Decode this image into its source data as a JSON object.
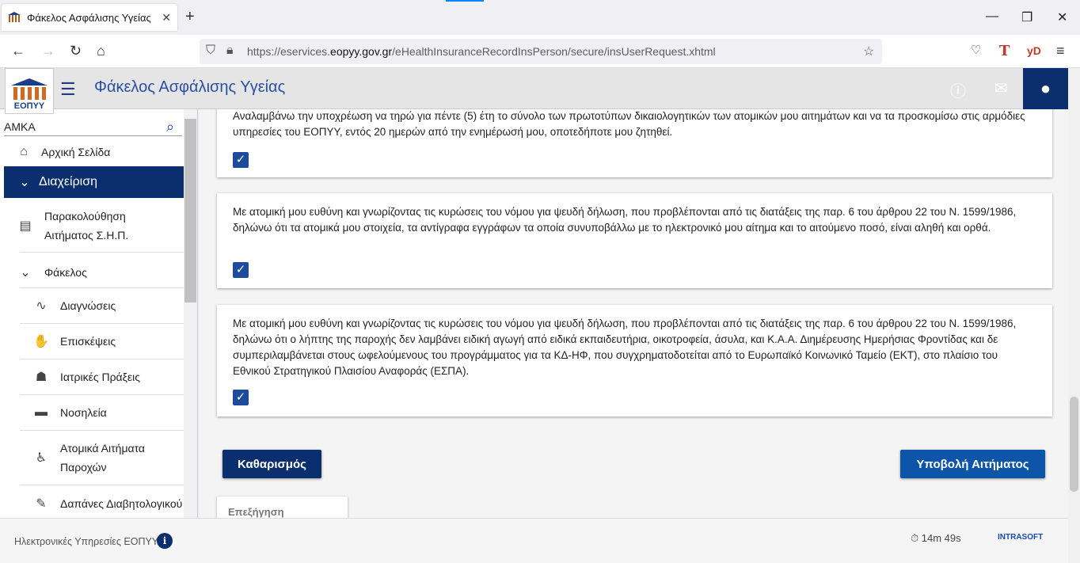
{
  "browser": {
    "tab_title": "Φάκελος Ασφάλισης Υγείας",
    "url_prefix": "https://eservices.",
    "url_domain": "eopyy.gov.gr",
    "url_path": "/eHealthInsuranceRecordInsPerson/secure/insUserRequest.xhtml",
    "ext_t": "T",
    "ext_yd": "yD"
  },
  "app": {
    "logo_text": "ΕΟΠΥΥ",
    "title": "Φάκελος Ασφάλισης Υγείας",
    "accent": "#0b2e6f"
  },
  "sidebar": {
    "search_value": "ΑΜΚΑ",
    "items": [
      {
        "label": "Αρχική Σελίδα",
        "icon": "home-icon"
      },
      {
        "label": "Διαχείριση",
        "icon": "chevron-down-icon"
      },
      {
        "label": "Παρακολούθηση",
        "label2": "Αιτήματος Σ.Η.Π.",
        "icon": "document-icon"
      },
      {
        "label": "Φάκελος",
        "icon": "chevron-down-icon"
      },
      {
        "label": "Διαγνώσεις",
        "icon": "pulse-icon"
      },
      {
        "label": "Επισκέψεις",
        "icon": "visit-icon"
      },
      {
        "label": "Ιατρικές Πράξεις",
        "icon": "doctor-icon"
      },
      {
        "label": "Νοσηλεία",
        "icon": "bed-icon"
      },
      {
        "label": "Ατομικά Αιτήματα",
        "label2": "Παροχών",
        "icon": "wheelchair-icon"
      },
      {
        "label": "Δαπάνες Διαβητολογικού",
        "icon": "diabetes-icon"
      }
    ]
  },
  "main": {
    "cards": [
      {
        "text": "Αναλαμβάνω την υποχρέωση να τηρώ για πέντε (5) έτη το σύνολο των πρωτοτύπων δικαιολογητικών των ατομικών μου αιτημάτων και να τα προσκομίσω στις αρμόδιες υπηρεσίες του ΕΟΠΥΥ, εντός 20 ημερών από την ενημέρωσή μου, οποτεδήποτε μου ζητηθεί.",
        "checked": true
      },
      {
        "text": "Με ατομική μου ευθύνη και γνωρίζοντας τις κυρώσεις του νόμου για ψευδή δήλωση, που προβλέπονται από τις διατάξεις της παρ. 6 του άρθρου 22 του Ν. 1599/1986, δηλώνω ότι τα ατομικά μου στοιχεία, τα αντίγραφα εγγράφων τα οποία συνυποβάλλω με το ηλεκτρονικό μου αίτημα και το αιτούμενο ποσό, είναι αληθή και ορθά.",
        "checked": true
      },
      {
        "text": "Με ατομική μου ευθύνη και γνωρίζοντας τις κυρώσεις του νόμου για ψευδή δήλωση, που προβλέπονται από τις διατάξεις της παρ. 6 του άρθρου 22 του Ν. 1599/1986, δηλώνω ότι ο λήπτης της παροχής δεν λαμβάνει ειδική αγωγή από ειδικά εκπαιδευτήρια, οικοτροφεία, άσυλα, και Κ.Α.Α. Διημέρευσης Ημερήσιας Φροντίδας και δε συμπεριλαμβάνεται στους ωφελούμενους του προγράμματος για τα ΚΔ-ΗΦ, που συγχρηματοδοτείται από το Ευρωπαϊκό Κοινωνικό Ταμείο (ΕΚΤ), στο πλαίσιο του Εθνικού Στρατηγικού Πλαισίου Αναφοράς (ΕΣΠΑ).",
        "checked": true
      }
    ],
    "clear_button": "Καθαρισμός",
    "submit_button": "Υποβολή Αιτήματος",
    "explain_label": "Επεξήγηση"
  },
  "footer": {
    "text": "Ηλεκτρονικές Υπηρεσίες ΕΟΠΥΥ",
    "timer": "14m 49s",
    "brand": "INTRASOFT"
  }
}
